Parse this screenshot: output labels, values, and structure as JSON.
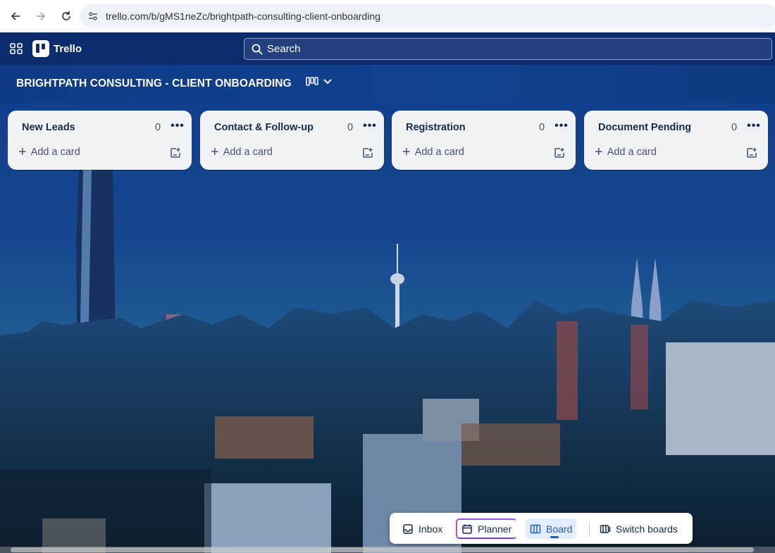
{
  "browser": {
    "url": "trello.com/b/gMS1neZc/brightpath-consulting-client-onboarding"
  },
  "header": {
    "app_name": "Trello",
    "search_placeholder": "Search"
  },
  "board": {
    "title": "BRIGHTPATH CONSULTING - CLIENT ONBOARDING"
  },
  "lists": [
    {
      "title": "New Leads",
      "count": "0",
      "add_label": "Add a card"
    },
    {
      "title": "Contact & Follow-up",
      "count": "0",
      "add_label": "Add a card"
    },
    {
      "title": "Registration",
      "count": "0",
      "add_label": "Add a card"
    },
    {
      "title": "Document Pending",
      "count": "0",
      "add_label": "Add a card"
    }
  ],
  "switcher": {
    "inbox": "Inbox",
    "planner": "Planner",
    "board": "Board",
    "switch_boards": "Switch boards"
  },
  "icons": {
    "apps": "apps-grid-icon",
    "search": "search-icon",
    "board_view": "board-view-icon",
    "template": "card-template-icon"
  },
  "colors": {
    "header_bg": "#0b2d6d",
    "board_header_bg": "#12438f",
    "list_bg": "#f1f2f4",
    "active_tab": "#1d5cd4"
  }
}
